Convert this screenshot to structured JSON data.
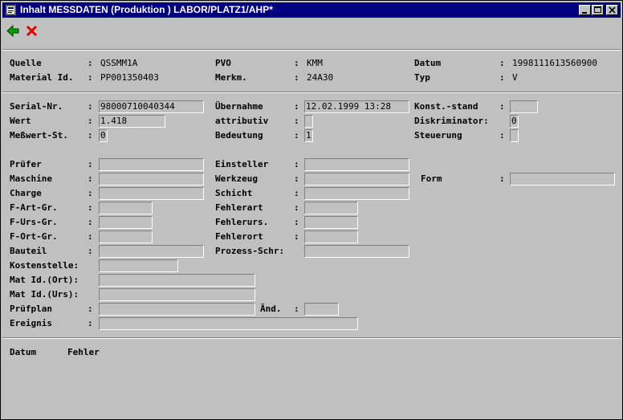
{
  "window": {
    "title": "Inhalt MESSDATEN (Produktion ) LABOR/PLATZ1/AHP*"
  },
  "toolbar": {
    "back_icon": "green-left-arrow-icon",
    "cancel_icon": "red-x-icon"
  },
  "header": {
    "quelle_label": "Quelle",
    "quelle_value": "QSSMM1A",
    "pvo_label": "PVO",
    "pvo_value": "KMM",
    "datum_label": "Datum",
    "datum_value": "1998111613560900",
    "material_label": "Material Id.",
    "material_value": "PP001350403",
    "merkm_label": "Merkm.",
    "merkm_value": "24A30",
    "typ_label": "Typ",
    "typ_value": "V"
  },
  "measure": {
    "serial_label": "Serial-Nr.",
    "serial_value": "98000710040344",
    "uebernahme_label": "Übernahme",
    "uebernahme_value": "12.02.1999 13:28",
    "konst_label": "Konst.-stand",
    "konst_value": "",
    "wert_label": "Wert",
    "wert_value": "1.418",
    "attributiv_label": "attributiv",
    "attributiv_value": "",
    "diskr_label": "Diskriminator:",
    "diskr_value": "0",
    "messwert_label": "Meßwert-St.",
    "messwert_value": "0",
    "bedeutung_label": "Bedeutung",
    "bedeutung_value": "1",
    "steuerung_label": "Steuerung",
    "steuerung_value": ""
  },
  "details": {
    "pruefer_label": "Prüfer",
    "pruefer_value": "",
    "einsteller_label": "Einsteller",
    "einsteller_value": "",
    "maschine_label": "Maschine",
    "maschine_value": "",
    "werkzeug_label": "Werkzeug",
    "werkzeug_value": "",
    "form_label": "Form",
    "form_value": "",
    "charge_label": "Charge",
    "charge_value": "",
    "schicht_label": "Schicht",
    "schicht_value": "",
    "fartgr_label": "F-Art-Gr.",
    "fartgr_value": "",
    "fehlerart_label": "Fehlerart",
    "fehlerart_value": "",
    "fursgr_label": "F-Urs-Gr.",
    "fursgr_value": "",
    "fehlerurs_label": "Fehlerurs.",
    "fehlerurs_value": "",
    "fortgr_label": "F-Ort-Gr.",
    "fortgr_value": "",
    "fehlerort_label": "Fehlerort",
    "fehlerort_value": "",
    "bauteil_label": "Bauteil",
    "bauteil_value": "",
    "prozess_label": "Prozess-Schr:",
    "prozess_value": "",
    "kostenstelle_label": "Kostenstelle:",
    "kostenstelle_value": "",
    "matort_label": "Mat Id.(Ort):",
    "matort_value": "",
    "maturs_label": "Mat Id.(Urs):",
    "maturs_value": "",
    "pruefplan_label": "Prüfplan",
    "pruefplan_value": "",
    "aend_label": "Änd.",
    "aend_value": "",
    "ereignis_label": "Ereignis",
    "ereignis_value": ""
  },
  "footer": {
    "datum_col": "Datum",
    "fehler_col": "Fehler"
  }
}
